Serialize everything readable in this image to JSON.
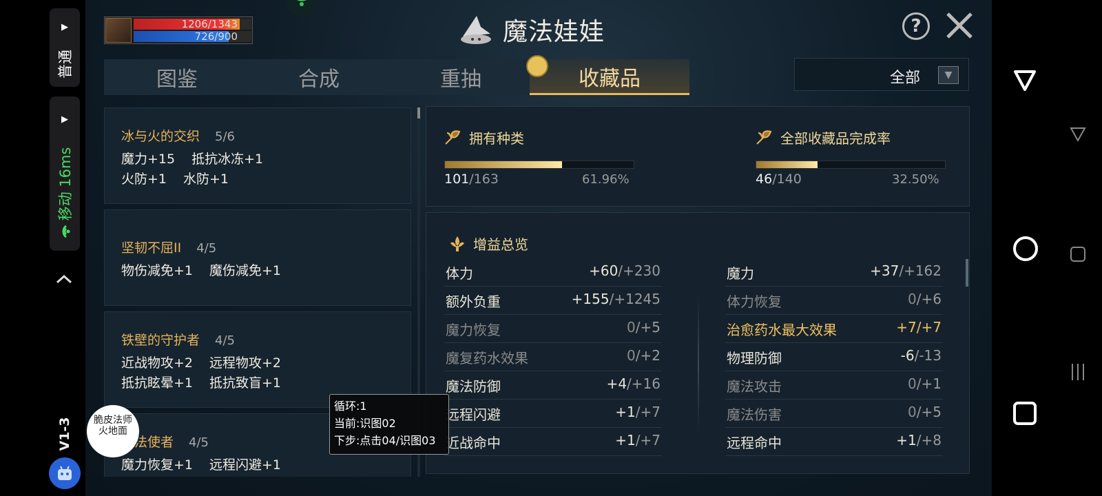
{
  "overlay": {
    "mode_label": "普通",
    "network_label": "移动 16ms",
    "version": "V1-3",
    "pill_arrow": "▶",
    "chevron": "^"
  },
  "player": {
    "hp": "1206/1343",
    "mp": "726/900",
    "hp_fraction": 0.898,
    "mp_fraction": 0.807
  },
  "header": {
    "title": "魔法娃娃",
    "help_label": "?"
  },
  "tabs": [
    {
      "label": "图鉴",
      "active": false
    },
    {
      "label": "合成",
      "active": false
    },
    {
      "label": "重抽",
      "active": false
    },
    {
      "label": "收藏品",
      "active": true
    }
  ],
  "filter": {
    "value": "全部",
    "arrow": "▼"
  },
  "collections": [
    {
      "name": "冰与火的交织",
      "count": "5/6",
      "effects": [
        [
          "魔力+15",
          "抵抗冰冻+1"
        ],
        [
          "火防+1",
          "水防+1"
        ]
      ]
    },
    {
      "name": "坚韧不屈II",
      "count": "4/5",
      "effects": [
        [
          "物伤减免+1",
          "魔伤减免+1"
        ]
      ]
    },
    {
      "name": "铁壁的守护者",
      "count": "4/5",
      "effects": [
        [
          "近战物攻+2",
          "远程物攻+2"
        ],
        [
          "抵抗眩晕+1",
          "抵抗致盲+1"
        ]
      ]
    },
    {
      "name": "魔法使者",
      "count": "4/5",
      "effects": [
        [
          "魔力恢复+1",
          "远程闪避+1"
        ]
      ]
    }
  ],
  "summary": {
    "owned": {
      "label": "拥有种类",
      "have": "101",
      "total": "/163",
      "percent": "61.96%",
      "fraction": 0.6196
    },
    "completion": {
      "label": "全部收藏品完成率",
      "have": "46",
      "total": "/140",
      "percent": "32.50%",
      "fraction": 0.325
    }
  },
  "buffs": {
    "title": "增益总览",
    "left": [
      {
        "label": "体力",
        "cur": "+60",
        "max": "/+230",
        "style": "normal"
      },
      {
        "label": "额外负重",
        "cur": "+155",
        "max": "/+1245",
        "style": "normal"
      },
      {
        "label": "魔力恢复",
        "cur": "0",
        "max": "/+5",
        "style": "dim"
      },
      {
        "label": "魔复药水效果",
        "cur": "0",
        "max": "/+2",
        "style": "dim"
      },
      {
        "label": "魔法防御",
        "cur": "+4",
        "max": "/+16",
        "style": "normal"
      },
      {
        "label": "远程闪避",
        "cur": "+1",
        "max": "/+7",
        "style": "normal"
      },
      {
        "label": "近战命中",
        "cur": "+1",
        "max": "/+7",
        "style": "normal"
      }
    ],
    "right": [
      {
        "label": "魔力",
        "cur": "+37",
        "max": "/+162",
        "style": "normal"
      },
      {
        "label": "体力恢复",
        "cur": "0",
        "max": "/+6",
        "style": "dim"
      },
      {
        "label": "治愈药水最大效果",
        "cur": "+7",
        "max": "/+7",
        "style": "gold"
      },
      {
        "label": "物理防御",
        "cur": "-6",
        "max": "/-13",
        "style": "normal"
      },
      {
        "label": "魔法攻击",
        "cur": "0",
        "max": "/+1",
        "style": "dim"
      },
      {
        "label": "魔法伤害",
        "cur": "0",
        "max": "/+5",
        "style": "dim"
      },
      {
        "label": "远程命中",
        "cur": "+1",
        "max": "/+8",
        "style": "normal"
      }
    ]
  },
  "tooltip": {
    "loop": "循环:1",
    "current": "当前:识图02",
    "next": "下步:点击04/识图03"
  },
  "bubble": {
    "text": "脆皮法师火地面"
  },
  "colors": {
    "accent_gold": "#e6b25a",
    "network_green": "#4cd964"
  }
}
